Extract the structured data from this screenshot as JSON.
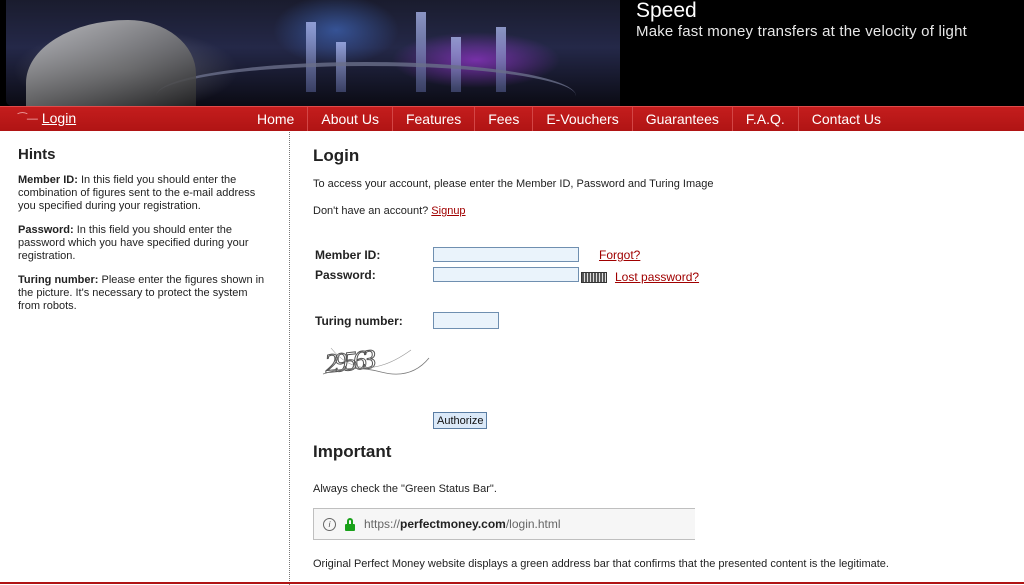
{
  "banner": {
    "title": "Speed",
    "subtitle": "Make fast money transfers at the velocity of light"
  },
  "nav": {
    "login_label": "Login",
    "items": [
      "Home",
      "About Us",
      "Features",
      "Fees",
      "E-Vouchers",
      "Guarantees",
      "F.A.Q.",
      "Contact Us"
    ]
  },
  "hints": {
    "title": "Hints",
    "member_id_label": "Member ID:",
    "member_id_text": " In this field you should enter the combination of figures sent to the e-mail address you specified during your registration.",
    "password_label": "Password:",
    "password_text": " In this field you should enter the password which you have specified during your registration.",
    "turing_label": "Turing number:",
    "turing_text": " Please enter the figures shown in the picture. It's necessary to protect the system from robots."
  },
  "login": {
    "title": "Login",
    "intro": "To access your account, please enter the Member ID, Password and Turing Image",
    "no_account_text": "Don't have an account? ",
    "signup_link": "Signup",
    "member_id_label": "Member ID:",
    "member_id_value": "",
    "forgot_link": "Forgot?",
    "password_label": "Password:",
    "password_value": "",
    "lost_password_link": "Lost password?",
    "turing_label": "Turing number:",
    "turing_value": "",
    "captcha_text": "29563",
    "authorize_button": "Authorize"
  },
  "important": {
    "title": "Important",
    "check_text": "Always check the \"Green Status Bar\".",
    "address_prefix": "https://",
    "address_domain": "perfectmoney.com",
    "address_path": "/login.html",
    "note": "Original Perfect Money website displays a green address bar that confirms that the presented content is the legitimate."
  },
  "colors": {
    "nav_red": "#b01414",
    "link_red": "#a00000",
    "lock_green": "#19a11a",
    "field_border": "#6f8fb0"
  }
}
